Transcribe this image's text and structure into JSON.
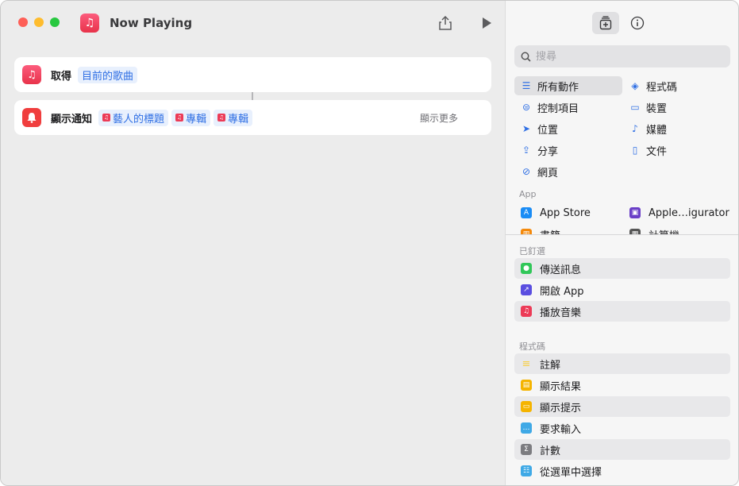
{
  "window": {
    "title": "Now Playing"
  },
  "actions": [
    {
      "label": "取得",
      "token": "目前的歌曲"
    },
    {
      "label": "顯示通知",
      "tokens": [
        "藝人的標題",
        "專輯",
        "專輯"
      ],
      "show_more": "顯示更多"
    }
  ],
  "sidebar": {
    "search_placeholder": "搜尋",
    "categories": [
      {
        "label": "所有動作",
        "icon": "list-icon"
      },
      {
        "label": "程式碼",
        "icon": "scripting-icon"
      },
      {
        "label": "控制項目",
        "icon": "toggle-icon"
      },
      {
        "label": "裝置",
        "icon": "display-icon"
      },
      {
        "label": "位置",
        "icon": "location-icon"
      },
      {
        "label": "媒體",
        "icon": "music-note-icon"
      },
      {
        "label": "分享",
        "icon": "share-icon"
      },
      {
        "label": "文件",
        "icon": "document-icon"
      },
      {
        "label": "網頁",
        "icon": "compass-icon"
      }
    ],
    "app_header": "App",
    "apps": [
      {
        "label": "App Store",
        "icon": "app-store-icon",
        "color": "#1a8cf5"
      },
      {
        "label": "Apple…igurator",
        "icon": "apple-configurator-icon",
        "color": "#6a3fc7"
      },
      {
        "label": "書籍",
        "icon": "books-icon",
        "color": "#f4890b"
      },
      {
        "label": "計算機",
        "icon": "calculator-icon",
        "color": "#555555"
      }
    ],
    "pinned_header": "已釘選",
    "pinned": [
      {
        "label": "傳送訊息",
        "icon": "messages-icon",
        "color": "#31c759"
      },
      {
        "label": "開啟 App",
        "icon": "open-app-icon",
        "color": "#5a4ee0"
      },
      {
        "label": "播放音樂",
        "icon": "music-icon",
        "color": "#ec3b57"
      }
    ],
    "scripting_header": "程式碼",
    "scripting": [
      {
        "label": "註解",
        "icon": "comment-icon",
        "color": "#f7cf46"
      },
      {
        "label": "顯示結果",
        "icon": "show-result-icon",
        "color": "#f5b400"
      },
      {
        "label": "顯示提示",
        "icon": "show-alert-icon",
        "color": "#f5b400"
      },
      {
        "label": "要求輸入",
        "icon": "ask-input-icon",
        "color": "#3fa9e6"
      },
      {
        "label": "計數",
        "icon": "count-icon",
        "color": "#7c7c80"
      },
      {
        "label": "從選單中選擇",
        "icon": "choose-menu-icon",
        "color": "#3fa9e6"
      }
    ]
  }
}
